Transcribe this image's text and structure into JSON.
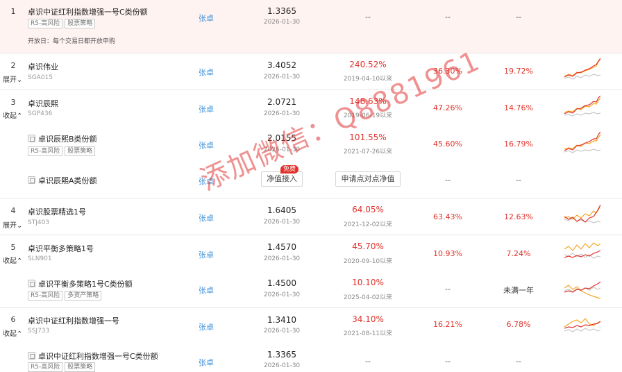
{
  "colors": {
    "accent_red": "#e0322b",
    "manager_blue": "#3b8fd9",
    "highlight_bg": "#fff3f2"
  },
  "rows": [
    {
      "idx": "1",
      "toggle": "",
      "name": "卓识中证红利指数增强一号C类份额",
      "code": "",
      "tags": [
        "R5-高风险",
        "股票策略"
      ],
      "open_day": "开放日：每个交易日都开放申购",
      "manager": "张卓",
      "nav": "1.3365",
      "nav_date": "2026-01-30",
      "ret": "--",
      "since": "",
      "y1": "--",
      "y3": "--"
    },
    {
      "idx": "2",
      "toggle": "展开",
      "name": "卓识伟业",
      "code": "SGA015",
      "tags": [],
      "manager": "张卓",
      "nav": "3.4052",
      "nav_date": "2026-01-30",
      "ret": "240.52%",
      "since": "2019-04-10以来",
      "y1": "36.30%",
      "y3": "19.72%"
    },
    {
      "idx": "3",
      "toggle": "收起",
      "name": "卓识辰熙",
      "code": "SGP436",
      "tags": [],
      "manager": "张卓",
      "nav": "2.0721",
      "nav_date": "2026-01-30",
      "ret": "148.63%",
      "since": "2019-06-19以来",
      "y1": "47.26%",
      "y3": "14.76%"
    },
    {
      "idx": "",
      "toggle": "",
      "name": "卓识辰熙B类份额",
      "code": "",
      "tags": [
        "R5-高风险",
        "股票策略"
      ],
      "manager": "张卓",
      "nav": "2.0155",
      "nav_date": "2026-01-30",
      "ret": "101.55%",
      "since": "2021-07-26以来",
      "y1": "45.60%",
      "y3": "16.79%"
    },
    {
      "idx": "",
      "toggle": "",
      "name": "卓识辰熙A类份额",
      "code": "",
      "tags": [],
      "manager": "张卓",
      "nav": "",
      "nav_date": "",
      "ret": "",
      "since": "",
      "y1": "--",
      "y3": "--",
      "btn_nav": "净值接入",
      "btn_badge": "免费",
      "btn_apply": "申请点对点净值"
    },
    {
      "idx": "4",
      "toggle": "展开",
      "name": "卓识股票精选1号",
      "code": "STJ403",
      "tags": [],
      "manager": "张卓",
      "nav": "1.6405",
      "nav_date": "2026-01-30",
      "ret": "64.05%",
      "since": "2021-12-02以来",
      "y1": "63.43%",
      "y3": "12.63%"
    },
    {
      "idx": "5",
      "toggle": "收起",
      "name": "卓识平衡多策略1号",
      "code": "SLN901",
      "tags": [],
      "manager": "张卓",
      "nav": "1.4570",
      "nav_date": "2026-01-30",
      "ret": "45.70%",
      "since": "2020-09-10以来",
      "y1": "10.93%",
      "y3": "7.24%"
    },
    {
      "idx": "",
      "toggle": "",
      "name": "卓识平衡多策略1号C类份额",
      "code": "",
      "tags": [
        "R5-高风险",
        "多资产策略"
      ],
      "manager": "张卓",
      "nav": "1.4500",
      "nav_date": "2026-01-30",
      "ret": "10.10%",
      "since": "2025-04-02以来",
      "y1": "--",
      "y3": "未满一年"
    },
    {
      "idx": "6",
      "toggle": "收起",
      "name": "卓识中证红利指数增强一号",
      "code": "SSJ733",
      "tags": [],
      "manager": "张卓",
      "nav": "1.3410",
      "nav_date": "2026-01-30",
      "ret": "34.10%",
      "since": "2021-08-11以来",
      "y1": "16.21%",
      "y3": "6.78%"
    },
    {
      "idx": "",
      "toggle": "",
      "name": "卓识中证红利指数增强一号C类份额",
      "code": "",
      "tags": [
        "R5-高风险",
        "股票策略"
      ],
      "manager": "张卓",
      "nav": "1.3365",
      "nav_date": "2026-01-30",
      "ret": "--",
      "since": "",
      "y1": "--",
      "y3": "--"
    }
  ],
  "watermark": "添加微信：Q8881961"
}
